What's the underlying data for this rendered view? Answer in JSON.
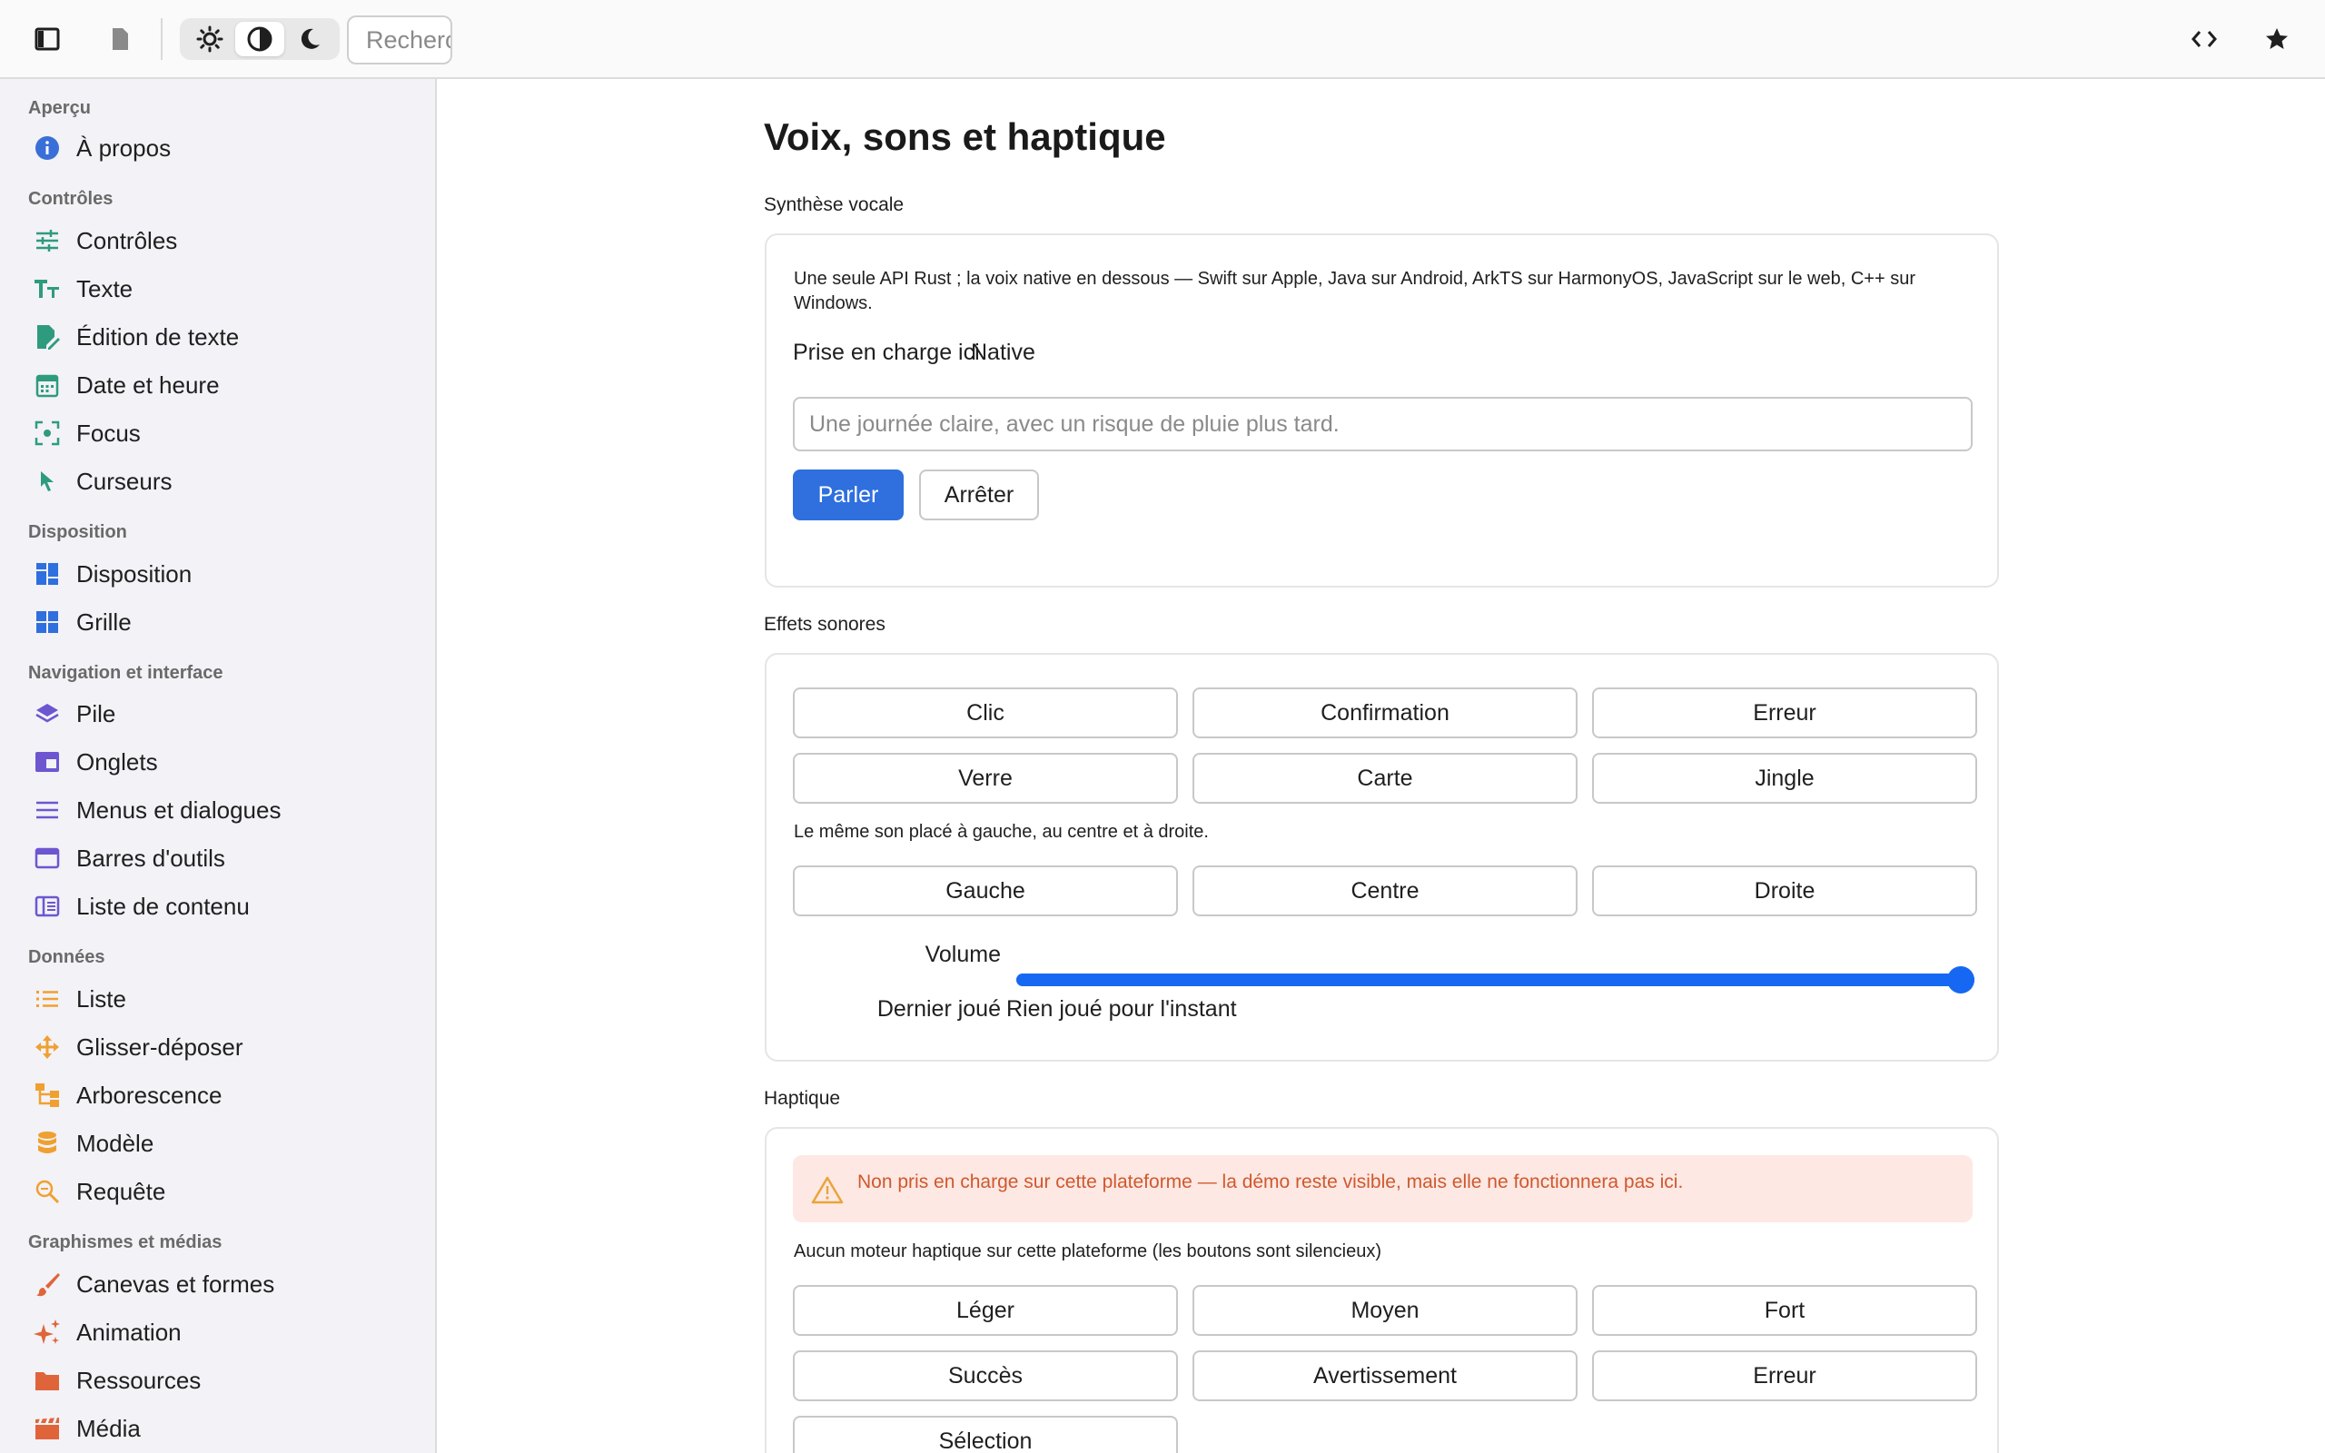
{
  "toolbar": {
    "search_placeholder": "Rechercher",
    "icons": [
      "sidebar-toggle-icon",
      "file-icon",
      "sun-icon",
      "contrast-icon",
      "moon-icon",
      "code-icon",
      "star-icon"
    ]
  },
  "sidebar": {
    "sections": {
      "apercu": "Aperçu",
      "controles": "Contrôles",
      "disposition": "Disposition",
      "navigation": "Navigation et interface",
      "donnees": "Données",
      "graphismes": "Graphismes et médias"
    },
    "items": {
      "a_propos": "À propos",
      "controles": "Contrôles",
      "texte": "Texte",
      "edition_texte": "Édition de texte",
      "date_heure": "Date et heure",
      "focus": "Focus",
      "curseurs": "Curseurs",
      "disposition": "Disposition",
      "grille": "Grille",
      "pile": "Pile",
      "onglets": "Onglets",
      "menus": "Menus et dialogues",
      "barres": "Barres d'outils",
      "liste_contenu": "Liste de contenu",
      "liste": "Liste",
      "glisser": "Glisser-déposer",
      "arborescence": "Arborescence",
      "modele": "Modèle",
      "requete": "Requête",
      "canevas": "Canevas et formes",
      "animation": "Animation",
      "ressources": "Ressources",
      "media": "Média"
    },
    "colors": {
      "info": "#3a6fd8",
      "green": "#2e9b7e",
      "blue": "#2f6fde",
      "purple": "#6d56d0",
      "orange": "#f0a030",
      "red": "#e0643a"
    }
  },
  "main": {
    "title": "Voix, sons et haptique",
    "tts": {
      "label": "Synthèse vocale",
      "description": "Une seule API Rust ; la voix native en dessous — Swift sur Apple, Java sur Android, ArkTS sur HarmonyOS, JavaScript sur le web, C++ sur Windows.",
      "support_label": "Prise en charge ici",
      "support_value": "Native",
      "placeholder": "Une journée claire, avec un risque de pluie plus tard.",
      "speak": "Parler",
      "stop": "Arrêter"
    },
    "sfx": {
      "label": "Effets sonores",
      "buttons": [
        "Clic",
        "Confirmation",
        "Erreur",
        "Verre",
        "Carte",
        "Jingle"
      ],
      "pan_description": "Le même son placé à gauche, au centre et à droite.",
      "pan_buttons": [
        "Gauche",
        "Centre",
        "Droite"
      ],
      "volume_label": "Volume",
      "volume_percent": 100,
      "last_label": "Dernier joué",
      "last_value": "Rien joué pour l'instant"
    },
    "haptics": {
      "label": "Haptique",
      "warning": "Non pris en charge sur cette plateforme — la démo reste visible, mais elle ne fonctionnera pas ici.",
      "note": "Aucun moteur haptique sur cette plateforme (les boutons sont silencieux)",
      "buttons": [
        "Léger",
        "Moyen",
        "Fort",
        "Succès",
        "Avertissement",
        "Erreur",
        "Sélection"
      ]
    }
  }
}
